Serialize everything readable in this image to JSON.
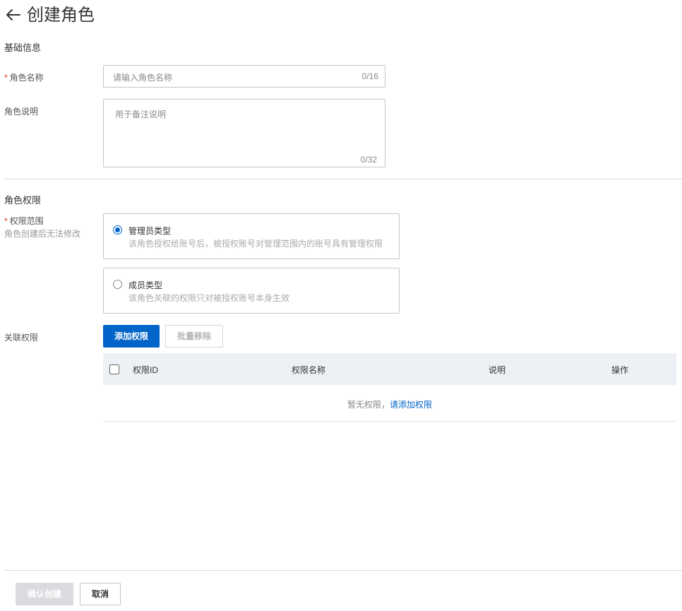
{
  "header": {
    "title": "创建角色"
  },
  "basic_info": {
    "section_title": "基础信息",
    "role_name": {
      "label": "角色名称",
      "required_mark": "*",
      "placeholder": "请输入角色名称",
      "counter": "0/16"
    },
    "role_desc": {
      "label": "角色说明",
      "placeholder": "用于备注说明",
      "counter": "0/32"
    }
  },
  "permissions": {
    "section_title": "角色权限",
    "scope": {
      "label": "权限范围",
      "required_mark": "*",
      "hint": "角色创建后无法修改",
      "options": [
        {
          "title": "管理员类型",
          "desc": "该角色授权给账号后，被授权账号对管理范围内的账号具有管理权限",
          "checked": true
        },
        {
          "title": "成员类型",
          "desc": "该角色关联的权限只对被授权账号本身生效",
          "checked": false
        }
      ]
    },
    "linked": {
      "label": "关联权限",
      "add_button": "添加权限",
      "remove_button": "批量移除",
      "columns": [
        "权限ID",
        "权限名称",
        "说明",
        "操作"
      ],
      "empty_text": "暂无权限，",
      "empty_link": "请添加权限"
    }
  },
  "footer": {
    "confirm_button": "确认创建",
    "cancel_button": "取消"
  },
  "colors": {
    "primary": "#0064c8",
    "required": "#d93026",
    "table_header_bg": "#edf0f5"
  }
}
